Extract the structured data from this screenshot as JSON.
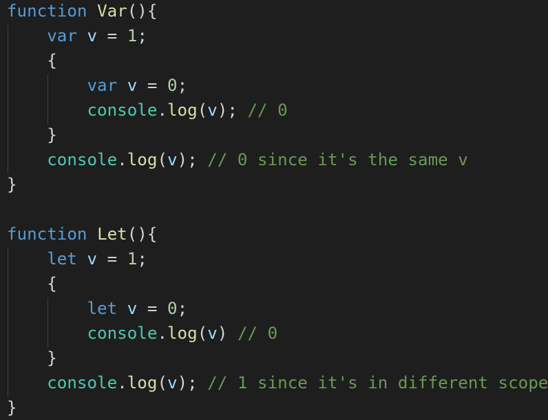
{
  "colors": {
    "background": "#1e1e1e",
    "keyword": "#569cd6",
    "function": "#dcdcaa",
    "variable": "#9cdcfe",
    "number": "#b5cea8",
    "object": "#4ec9b0",
    "comment": "#6a9955",
    "punctuation": "#d4d4d4",
    "indent_guide": "#404040"
  },
  "code": {
    "var_func": {
      "keyword": "function",
      "name": "Var",
      "open": "(){",
      "outer_decl": {
        "kw": "var",
        "name": "v",
        "eq": " = ",
        "val": "1",
        "end": ";"
      },
      "block_open": "{",
      "inner_decl": {
        "kw": "var",
        "name": "v",
        "eq": " = ",
        "val": "0",
        "end": ";"
      },
      "inner_log": {
        "obj": "console",
        "dot": ".",
        "method": "log",
        "open": "(",
        "arg": "v",
        "close": ");",
        "comment": "// 0"
      },
      "block_close": "}",
      "outer_log": {
        "obj": "console",
        "dot": ".",
        "method": "log",
        "open": "(",
        "arg": "v",
        "close": ");",
        "comment": "// 0 since it's the same v"
      },
      "close": "}"
    },
    "let_func": {
      "keyword": "function",
      "name": "Let",
      "open": "(){",
      "outer_decl": {
        "kw": "let",
        "name": "v",
        "eq": " = ",
        "val": "1",
        "end": ";"
      },
      "block_open": "{",
      "inner_decl": {
        "kw": "let",
        "name": "v",
        "eq": " = ",
        "val": "0",
        "end": ";"
      },
      "inner_log": {
        "obj": "console",
        "dot": ".",
        "method": "log",
        "open": "(",
        "arg": "v",
        "close": ")",
        "comment": "// 0"
      },
      "block_close": "}",
      "outer_log": {
        "obj": "console",
        "dot": ".",
        "method": "log",
        "open": "(",
        "arg": "v",
        "close": ");",
        "comment": "// 1 since it's in different scope"
      },
      "close": "}"
    }
  }
}
